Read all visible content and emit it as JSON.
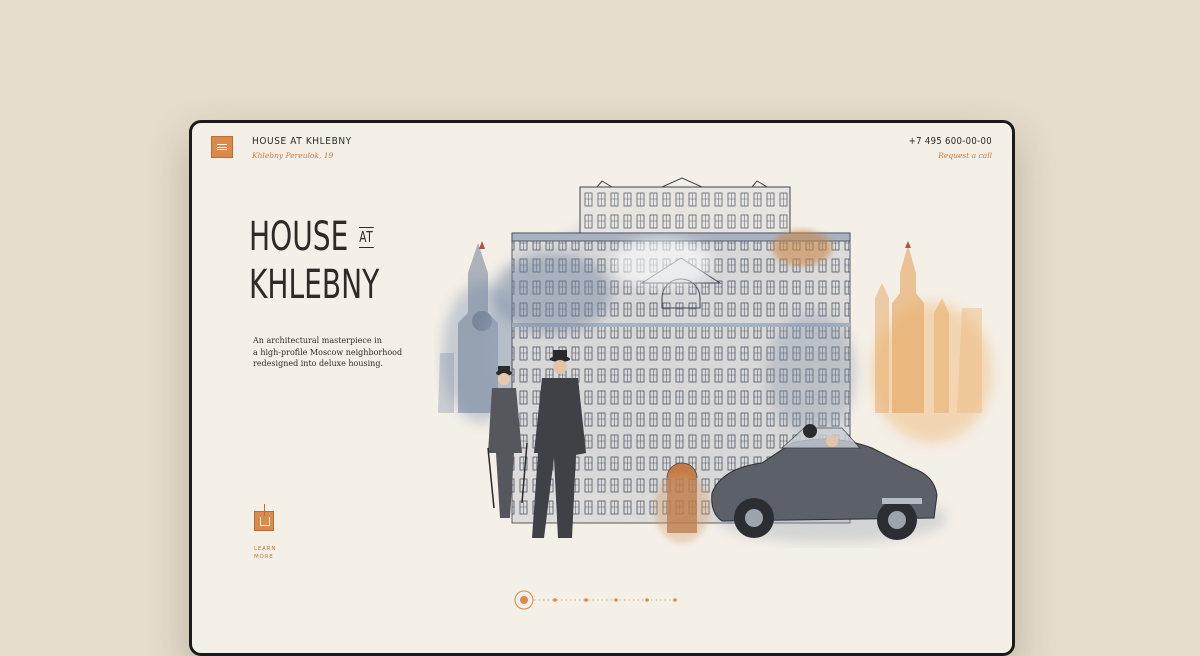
{
  "header": {
    "brand_title": "HOUSE AT KHLEBNY",
    "brand_subtitle": "Khlebny Pereulok, 19",
    "phone": "+7 495 600-00-00",
    "request_call": "Request a call",
    "menu_icon": "menu-icon"
  },
  "hero": {
    "title_line1_word": "HOUSE",
    "title_line1_small": "AT",
    "title_line2": "KHLEBNY",
    "description": [
      "An architectural masterpiece in",
      "a high-profile Moscow neighborhood",
      "redesigned into deluxe housing."
    ]
  },
  "learn_more": {
    "icon": "learn-more-icon",
    "label_line1": "LEARN",
    "label_line2": "MORE"
  },
  "illustration": {
    "subject": "watercolor-building-illustration",
    "elements": [
      "kremlin-tower-left",
      "apartment-building",
      "two-gentlemen-with-canes",
      "vintage-convertible-car",
      "kremlin-tower-right"
    ]
  },
  "pager": {
    "total_slides": 6,
    "active_index": 0
  },
  "colors": {
    "page_background": "#e5dccc",
    "frame_background": "#f4efe7",
    "accent": "#d98a4c",
    "text_dark": "#2d2a28",
    "watercolor_blue": "#8a9bb0",
    "watercolor_orange": "#e4a35c"
  }
}
